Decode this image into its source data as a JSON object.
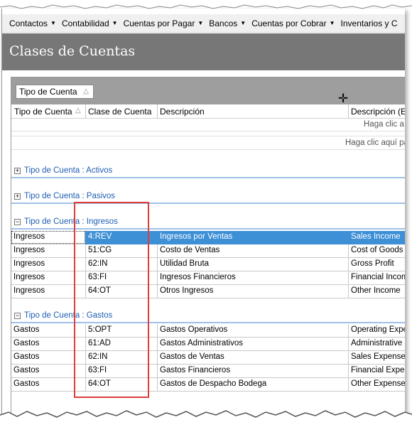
{
  "menu": [
    {
      "label": "Contactos"
    },
    {
      "label": "Contabilidad"
    },
    {
      "label": "Cuentas por Pagar"
    },
    {
      "label": "Bancos"
    },
    {
      "label": "Cuentas por Cobrar"
    },
    {
      "label": "Inventarios y C"
    }
  ],
  "page_title": "Clases de Cuentas",
  "group_chip": {
    "label": "Tipo de Cuenta",
    "sort": "△"
  },
  "columns": {
    "tipo": "Tipo de Cuenta",
    "tipo_sort": "△",
    "clase": "Clase de Cuenta",
    "descripcion": "Descripción",
    "descripcion_en": "Descripción (EN"
  },
  "filter_row_text": "Haga clic a",
  "new_row_text": "Haga clic aquí pa",
  "groups": [
    {
      "label": "Tipo de Cuenta : Activos",
      "expander": "+"
    },
    {
      "label": "Tipo de Cuenta : Pasivos",
      "expander": "+"
    },
    {
      "label": "Tipo de Cuenta : Ingresos",
      "expander": "−"
    },
    {
      "label": "Tipo de Cuenta : Gastos",
      "expander": "−"
    }
  ],
  "ingresos_rows": [
    {
      "tipo": "Ingresos",
      "clase": "4:REV",
      "descripcion": "Ingresos por Ventas",
      "descripcion_en": "Sales Income"
    },
    {
      "tipo": "Ingresos",
      "clase": "51:CG",
      "descripcion": "Costo de Ventas",
      "descripcion_en": "Cost of Goods S"
    },
    {
      "tipo": "Ingresos",
      "clase": "62:IN",
      "descripcion": "Utilidad Bruta",
      "descripcion_en": "Gross Profit"
    },
    {
      "tipo": "Ingresos",
      "clase": "63:FI",
      "descripcion": "Ingresos Financieros",
      "descripcion_en": "Financial Incom"
    },
    {
      "tipo": "Ingresos",
      "clase": "64:OT",
      "descripcion": "Otros Ingresos",
      "descripcion_en": "Other Income"
    }
  ],
  "gastos_rows": [
    {
      "tipo": "Gastos",
      "clase": "5:OPT",
      "descripcion": "Gastos Operativos",
      "descripcion_en": "Operating Expe"
    },
    {
      "tipo": "Gastos",
      "clase": "61:AD",
      "descripcion": "Gastos Administrativos",
      "descripcion_en": "Administrative E"
    },
    {
      "tipo": "Gastos",
      "clase": "62:IN",
      "descripcion": "Gastos de Ventas",
      "descripcion_en": "Sales Expenses"
    },
    {
      "tipo": "Gastos",
      "clase": "63:FI",
      "descripcion": "Gastos Financieros",
      "descripcion_en": "Financial Exper"
    },
    {
      "tipo": "Gastos",
      "clase": "64:OT",
      "descripcion": "Gastos de Despacho Bodega",
      "descripcion_en": "Other Expenses"
    }
  ],
  "colors": {
    "title_bar": "#777777",
    "group_text": "#1f5fb4",
    "selection": "#3d8fd6",
    "highlight_box": "#e03c3c"
  }
}
